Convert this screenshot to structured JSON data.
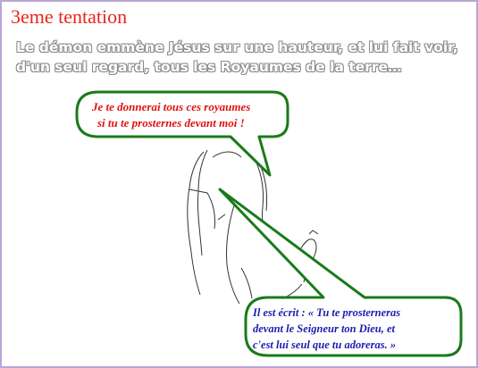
{
  "slide": {
    "title": "3eme tentation",
    "narration_lines": [
      "Le démon emmène Jésus sur une hauteur,  et lui fait voir,",
      "d'un seul regard,  tous les Royaumes de la terre…"
    ]
  },
  "bubbles": {
    "devil": {
      "lines": [
        "Je te donnerai tous ces royaumes",
        "si tu te prosternes devant moi !"
      ],
      "text_color": "#e01010",
      "border_color": "#1a7a1a"
    },
    "jesus": {
      "lines": [
        "Il est écrit :   « Tu te prosterneras",
        "devant le Seigneur ton Dieu, et",
        "c'est lui seul que tu adoreras. »"
      ],
      "text_color": "#1c1cb0",
      "border_color": "#1a7a1a"
    }
  },
  "colors": {
    "frame_border": "#b9a6d6",
    "title": "#e8241c",
    "narration_outline": "#8c8c8c"
  },
  "illustration": "sketch-figures"
}
